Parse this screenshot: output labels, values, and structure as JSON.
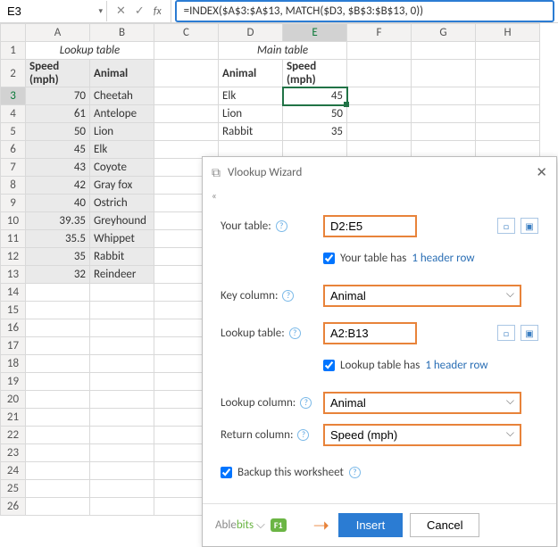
{
  "nameBox": "E3",
  "formula": "=INDEX($A$3:$A$13, MATCH($D3, $B$3:$B$13, 0))",
  "columns": [
    "A",
    "B",
    "C",
    "D",
    "E",
    "F",
    "G",
    "H"
  ],
  "lookupTitle": "Lookup table",
  "mainTitle": "Main table",
  "headerA": "Speed (mph)",
  "headerB": "Animal",
  "headerD": "Animal",
  "headerE": "Speed (mph)",
  "lookup": [
    {
      "s": "70",
      "a": "Cheetah"
    },
    {
      "s": "61",
      "a": "Antelope"
    },
    {
      "s": "50",
      "a": "Lion"
    },
    {
      "s": "45",
      "a": "Elk"
    },
    {
      "s": "43",
      "a": "Coyote"
    },
    {
      "s": "42",
      "a": "Gray fox"
    },
    {
      "s": "40",
      "a": "Ostrich"
    },
    {
      "s": "39.35",
      "a": "Greyhound"
    },
    {
      "s": "35.5",
      "a": "Whippet"
    },
    {
      "s": "35",
      "a": "Rabbit"
    },
    {
      "s": "32",
      "a": "Reindeer"
    }
  ],
  "main": [
    {
      "a": "Elk",
      "s": "45"
    },
    {
      "a": "Lion",
      "s": "50"
    },
    {
      "a": "Rabbit",
      "s": "35"
    }
  ],
  "dialog": {
    "title": "Vlookup Wizard",
    "yourTableLbl": "Your table:",
    "yourTableVal": "D2:E5",
    "chk1a": "Your table has",
    "chk1b": "1 header row",
    "keyColLbl": "Key column:",
    "keyColVal": "Animal",
    "lookupTableLbl": "Lookup table:",
    "lookupTableVal": "A2:B13",
    "chk2a": "Lookup table has",
    "chk2b": "1 header row",
    "lookupColLbl": "Lookup column:",
    "lookupColVal": "Animal",
    "returnColLbl": "Return column:",
    "returnColVal": "Speed (mph)",
    "backup": "Backup this worksheet",
    "brand1": "Able",
    "brand2": "bits",
    "f1": "F1",
    "insert": "Insert",
    "cancel": "Cancel"
  }
}
